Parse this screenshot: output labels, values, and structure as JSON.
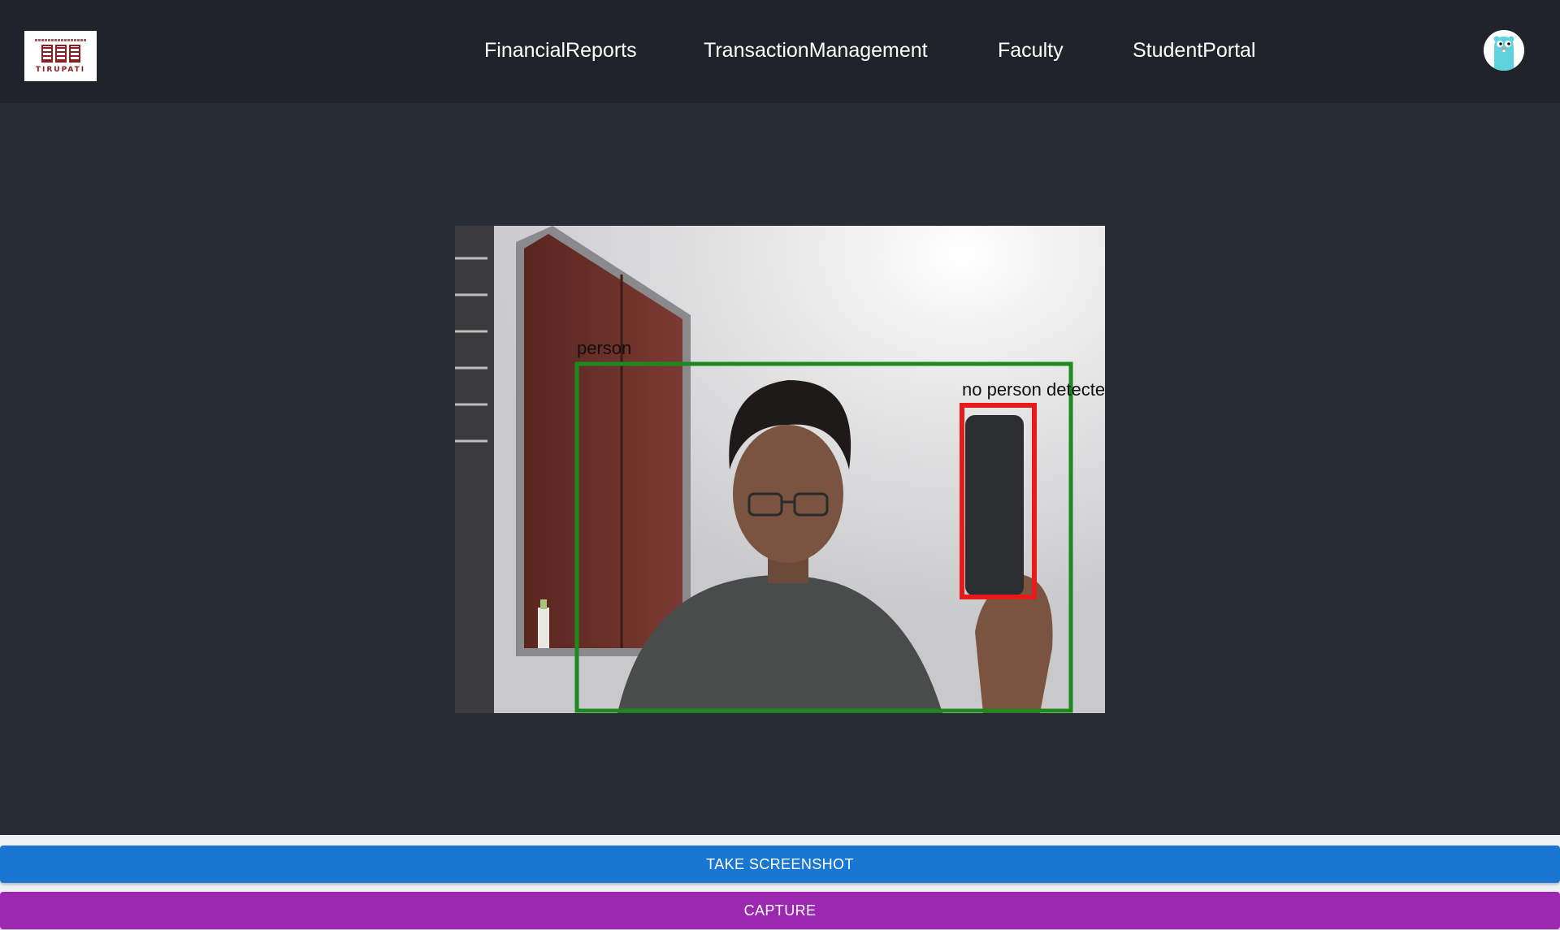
{
  "header": {
    "logo": {
      "icon": "institute-logo",
      "text": "TIRUPATI"
    },
    "nav": [
      {
        "label": "FinancialReports"
      },
      {
        "label": "TransactionManagement"
      },
      {
        "label": "Faculty"
      },
      {
        "label": "StudentPortal"
      }
    ],
    "avatar_icon": "gopher-avatar-icon"
  },
  "camera": {
    "detections": [
      {
        "label": "person",
        "box_color": "#1e8a1e"
      },
      {
        "label": "no person detecte",
        "box_color": "#e81b1b"
      }
    ]
  },
  "actions": {
    "screenshot_label": "TAKE SCREENSHOT",
    "capture_label": "CAPTURE",
    "screenshot_color": "#1976d2",
    "capture_color": "#9c27b0"
  }
}
